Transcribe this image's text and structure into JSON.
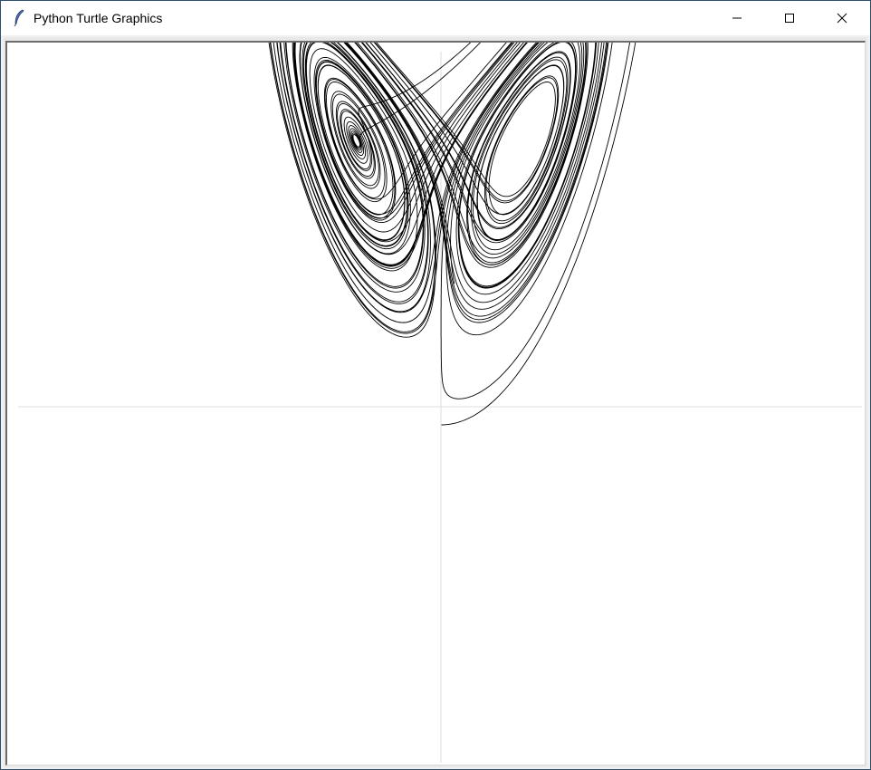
{
  "window": {
    "title": "Python Turtle Graphics",
    "icon": "feather-icon",
    "controls": [
      "minimize-icon",
      "maximize-icon",
      "close-icon"
    ]
  },
  "canvas": {
    "background": "#ffffff",
    "axis_color": "#dcdcdc",
    "stroke_color": "#000000"
  }
}
